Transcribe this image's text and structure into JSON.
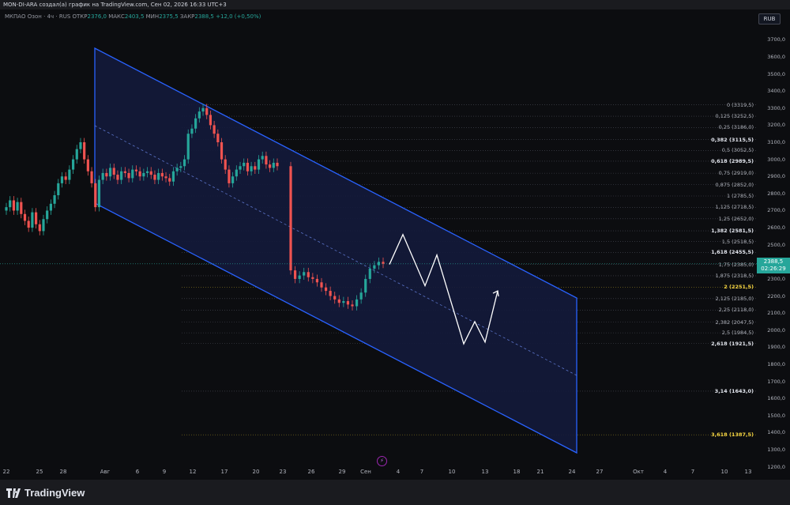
{
  "header": {
    "title": "MON-DI-ARA создал(а) график на TradingView.com, Сен 02, 2026 16:33 UTC+3"
  },
  "legend": {
    "symbol": "МКПАО Озон · 4ч · RUS",
    "open_label": "ОТКР",
    "open": "2376,0",
    "high_label": "МАКС",
    "high": "2403,5",
    "low_label": "МИН",
    "low": "2375,5",
    "close_label": "ЗАКР",
    "close": "2388,5",
    "change": "+12,0 (+0,50%)"
  },
  "currency": "RUB",
  "current_price": {
    "value": 2388.5,
    "label": "2388,5",
    "countdown": "02:26:29"
  },
  "colors": {
    "up": "#26a69a",
    "down": "#ef5350",
    "channel": "#2962ff",
    "channel_fill": "#131a3b",
    "projection": "#ffffff"
  },
  "chart_data": {
    "type": "candlestick",
    "price_axis": {
      "range": [
        1150,
        3800
      ],
      "ticks": [
        {
          "v": 3700,
          "label": "3700,0"
        },
        {
          "v": 3600,
          "label": "3600,0"
        },
        {
          "v": 3500,
          "label": "3500,0"
        },
        {
          "v": 3400,
          "label": "3400,0"
        },
        {
          "v": 3300,
          "label": "3300,0"
        },
        {
          "v": 3200,
          "label": "3200,0"
        },
        {
          "v": 3100,
          "label": "3100,0"
        },
        {
          "v": 3000,
          "label": "3000,0"
        },
        {
          "v": 2900,
          "label": "2900,0"
        },
        {
          "v": 2800,
          "label": "2800,0"
        },
        {
          "v": 2700,
          "label": "2700,0"
        },
        {
          "v": 2600,
          "label": "2600,0"
        },
        {
          "v": 2500,
          "label": "2500,0"
        },
        {
          "v": 2300,
          "label": "2300,0"
        },
        {
          "v": 2200,
          "label": "2200,0"
        },
        {
          "v": 2100,
          "label": "2100,0"
        },
        {
          "v": 2000,
          "label": "2000,0"
        },
        {
          "v": 1900,
          "label": "1900,0"
        },
        {
          "v": 1800,
          "label": "1800,0"
        },
        {
          "v": 1700,
          "label": "1700,0"
        },
        {
          "v": 1600,
          "label": "1600,0"
        },
        {
          "v": 1500,
          "label": "1500,0"
        },
        {
          "v": 1400,
          "label": "1400,0"
        },
        {
          "v": 1300,
          "label": "1300,0"
        },
        {
          "v": 1200,
          "label": "1200,0"
        }
      ]
    },
    "time_axis": {
      "ticks": [
        "22",
        "25",
        "28",
        "Авг",
        "6",
        "9",
        "12",
        "17",
        "20",
        "23",
        "26",
        "29",
        "Сен",
        "4",
        "7",
        "10",
        "13",
        "18",
        "21",
        "24",
        "27",
        "Окт",
        "4",
        "7",
        "10",
        "13"
      ]
    },
    "fib_levels": [
      {
        "ratio": "0",
        "price": "3319,5",
        "v": 3319.5
      },
      {
        "ratio": "0,125",
        "price": "3252,5",
        "v": 3252.5
      },
      {
        "ratio": "0,25",
        "price": "3186,0",
        "v": 3186.0
      },
      {
        "ratio": "0,382",
        "price": "3115,5",
        "v": 3115.5,
        "style": "strong"
      },
      {
        "ratio": "0,5",
        "price": "3052,5",
        "v": 3052.5
      },
      {
        "ratio": "0,618",
        "price": "2989,5",
        "v": 2989.5,
        "style": "strong"
      },
      {
        "ratio": "0,75",
        "price": "2919,0",
        "v": 2919.0
      },
      {
        "ratio": "0,875",
        "price": "2852,0",
        "v": 2852.0
      },
      {
        "ratio": "1",
        "price": "2785,5",
        "v": 2785.5
      },
      {
        "ratio": "1,125",
        "price": "2718,5",
        "v": 2718.5
      },
      {
        "ratio": "1,25",
        "price": "2652,0",
        "v": 2652.0
      },
      {
        "ratio": "1,382",
        "price": "2581,5",
        "v": 2581.5,
        "style": "strong"
      },
      {
        "ratio": "1,5",
        "price": "2518,5",
        "v": 2518.5
      },
      {
        "ratio": "1,618",
        "price": "2455,5",
        "v": 2455.5,
        "style": "strong"
      },
      {
        "ratio": "1,75",
        "price": "2385,0",
        "v": 2385.0
      },
      {
        "ratio": "1,875",
        "price": "2318,5",
        "v": 2318.5
      },
      {
        "ratio": "2",
        "price": "2251,5",
        "v": 2251.5,
        "style": "gold"
      },
      {
        "ratio": "2,125",
        "price": "2185,0",
        "v": 2185.0
      },
      {
        "ratio": "2,25",
        "price": "2118,0",
        "v": 2118.0
      },
      {
        "ratio": "2,382",
        "price": "2047,5",
        "v": 2047.5
      },
      {
        "ratio": "2,5",
        "price": "1984,5",
        "v": 1984.5
      },
      {
        "ratio": "2,618",
        "price": "1921,5",
        "v": 1921.5,
        "style": "strong"
      },
      {
        "ratio": "3,14",
        "price": "1643,0",
        "v": 1643.0,
        "style": "strong"
      },
      {
        "ratio": "3,618",
        "price": "1387,5",
        "v": 1387.5,
        "style": "gold"
      }
    ],
    "closes": [
      2720,
      2760,
      2700,
      2750,
      2680,
      2640,
      2600,
      2690,
      2620,
      2580,
      2650,
      2700,
      2740,
      2790,
      2860,
      2900,
      2880,
      2940,
      3000,
      3060,
      3100,
      3000,
      2930,
      2860,
      2720,
      2880,
      2920,
      2900,
      2950,
      2910,
      2880,
      2930,
      2920,
      2890,
      2940,
      2930,
      2900,
      2920,
      2930,
      2910,
      2880,
      2920,
      2900,
      2890,
      2870,
      2930,
      2950,
      2960,
      3000,
      3150,
      3180,
      3240,
      3280,
      3300,
      3260,
      3200,
      3150,
      3100,
      3000,
      2940,
      2860,
      2900,
      2940,
      2960,
      2980,
      2930,
      2960,
      2940,
      3000,
      3020,
      2970,
      2950,
      2980,
      2960,
      2350,
      2300,
      2320,
      2340,
      2310,
      2300,
      2280,
      2250,
      2230,
      2200,
      2180,
      2160,
      2170,
      2150,
      2140,
      2180,
      2220,
      2300,
      2360,
      2380,
      2400,
      2388.5
    ],
    "projection_path": [
      [
        2385,
        0
      ],
      [
        2560,
        1
      ],
      [
        2260,
        2
      ],
      [
        2440,
        3
      ],
      [
        1920,
        4
      ],
      [
        2050,
        5
      ],
      [
        1930,
        6
      ],
      [
        2230,
        7
      ]
    ]
  },
  "footer": {
    "brand": "TradingView"
  }
}
